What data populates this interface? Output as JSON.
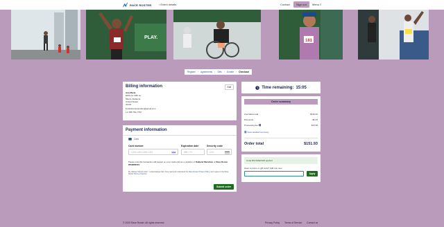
{
  "brand": {
    "name": "RACE ROSTER"
  },
  "topnav": {
    "event_link": "Event details",
    "contact": "Contact",
    "signout": "Sign out",
    "menu": "Menu"
  },
  "steps": [
    "Register",
    "Agreements",
    "Gifts",
    "Donate",
    "Checkout"
  ],
  "billing": {
    "title": "Billing information",
    "edit_label": "Edit",
    "name": "Ana Maria",
    "lines": [
      "8200 nw 30th ter",
      "Miami, Alabama",
      "United States",
      "33122"
    ],
    "email": "liondelcampoandres@gmail.com",
    "phone": "+1 305-762-7762"
  },
  "payment": {
    "title": "Payment information",
    "method_tab": "Card",
    "card_number_label": "Card number",
    "card_number_placeholder": "1234 1234 1234 1234",
    "card_brand": "visa",
    "expiration_label": "Expiration date",
    "expiration_placeholder": "MM / YY",
    "security_label": "Security code",
    "security_placeholder": "CVC",
    "statement_note_prefix": "Please note this transaction will appear on your credit card as a variation of",
    "statement_name": "Oakland Marathon",
    "statement_mid": "or",
    "statement_descriptor": "Race Roster 8559680515.",
    "fine_print_1": "By clicking \"Submit order\", I acknowledge that I have read and understand the",
    "fine_print_link_1": "Race Roster Privacy Policy",
    "fine_print_2": ", and I agree to the",
    "fine_print_link_2": "Race Roster Terms of Service",
    "submit_label": "Submit order"
  },
  "timer": {
    "label": "Time remaining:",
    "value": "15:05"
  },
  "summary": {
    "title": "Order summary",
    "rows": [
      {
        "label": "Ana Maria total",
        "value": "$145.00"
      },
      {
        "label": "Discounts",
        "value": "-$6.25"
      },
      {
        "label": "Processing fee",
        "value": "$13.18"
      }
    ],
    "details_link": "View detailed summary",
    "total_label": "Order total",
    "total_value": "$151.93"
  },
  "promo": {
    "applied_text": "Code BAYAREAS25 applied",
    "question": "Have a promo or gift code? Add one now",
    "input_value": "",
    "apply_label": "Apply"
  },
  "footer": {
    "copyright": "© 2025 Race Roster. All rights reserved.",
    "links": [
      "Privacy Policy",
      "Terms of Service",
      "Contact us"
    ]
  },
  "colors": {
    "page_bg": "#bb9bbb",
    "navy": "#1a2550",
    "green_button": "#1f6b1f",
    "link_blue": "#3355aa"
  }
}
